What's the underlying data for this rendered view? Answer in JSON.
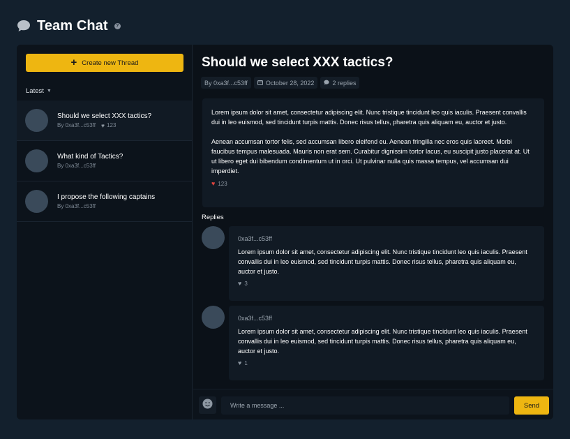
{
  "app": {
    "title": "Team Chat"
  },
  "sidebar": {
    "create_label": "Create new Thread",
    "filter_label": "Latest",
    "threads": [
      {
        "title": "Should we select XXX tactics?",
        "author": "By 0xa3f...c53ff",
        "likes": "123"
      },
      {
        "title": "What kind of Tactics?",
        "author": "By 0xa3f...c53ff"
      },
      {
        "title": "I propose the following captains",
        "author": "By 0xa3f...c53ff"
      }
    ]
  },
  "thread": {
    "title": "Should we select XXX tactics?",
    "author": "By 0xa3f...c53ff",
    "date": "October 28, 2022",
    "replies_count": "2 replies",
    "body": [
      "Lorem ipsum dolor sit amet, consectetur adipiscing elit. Nunc tristique tincidunt leo quis iaculis. Praesent convallis dui in leo euismod, sed tincidunt turpis mattis. Donec risus tellus, pharetra quis aliquam eu, auctor et justo.",
      "Aenean accumsan tortor felis, sed accumsan libero eleifend eu. Aenean fringilla nec eros quis laoreet. Morbi faucibus tempus malesuada. Mauris non erat sem. Curabitur dignissim tortor lacus, eu suscipit justo placerat at. Ut ut libero eget dui bibendum condimentum ut in orci. Ut pulvinar nulla quis massa tempus, vel accumsan dui imperdiet."
    ],
    "likes": "123"
  },
  "replies": {
    "label": "Replies",
    "items": [
      {
        "author": "0xa3f...c53ff",
        "body": "Lorem ipsum dolor sit amet, consectetur adipiscing elit. Nunc tristique tincidunt leo quis iaculis. Praesent convallis dui in leo euismod, sed tincidunt turpis mattis. Donec risus tellus, pharetra quis aliquam eu, auctor et justo.",
        "likes": "3"
      },
      {
        "author": "0xa3f...c53ff",
        "body": "Lorem ipsum dolor sit amet, consectetur adipiscing elit. Nunc tristique tincidunt leo quis iaculis. Praesent convallis dui in leo euismod, sed tincidunt turpis mattis. Donec risus tellus, pharetra quis aliquam eu, auctor et justo.",
        "likes": "1"
      }
    ]
  },
  "composer": {
    "placeholder": "Write a message ...",
    "send_label": "Send"
  },
  "colors": {
    "background": "#13202d",
    "panel": "#0b1118",
    "accent": "#eeb611",
    "like_active": "#e0443e"
  }
}
